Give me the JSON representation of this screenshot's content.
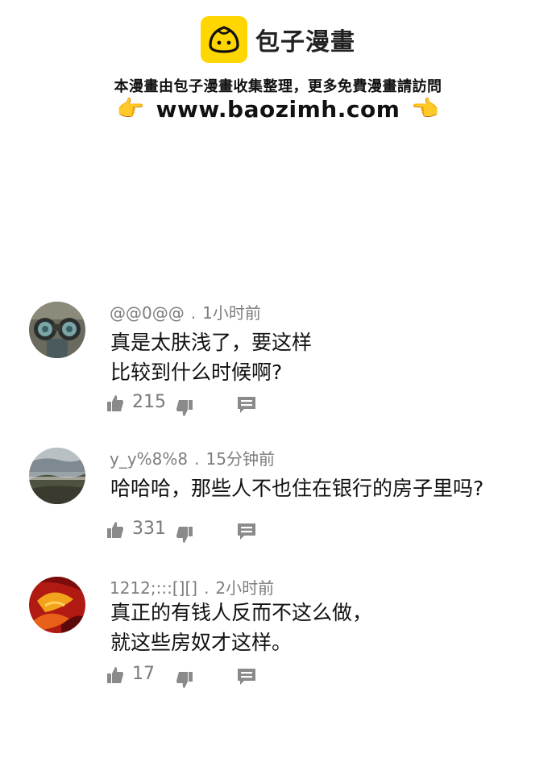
{
  "header": {
    "brand_name": "包子漫畫",
    "tagline": "本漫畫由包子漫畫收集整理，更多免費漫畫請訪問",
    "url": "www.baozimh.com",
    "left_hand": "👉",
    "right_hand": "👈",
    "logo_color": "#FFD600"
  },
  "comments": [
    {
      "username": "@@0@@",
      "separator": ".",
      "time": "1小时前",
      "lines": [
        "真是太肤浅了，要这样",
        "比较到什么时候啊?"
      ],
      "likes": "215",
      "avatar": "binoculars-avatar"
    },
    {
      "username": "y_y%8%8",
      "separator": ".",
      "time": "15分钟前",
      "lines": [
        "哈哈哈，那些人不也住在银行的房子里吗?"
      ],
      "likes": "331",
      "avatar": "landscape-avatar"
    },
    {
      "username": "1212;:::[][]",
      "separator": ".",
      "time": "2小时前",
      "lines": [
        "真正的有钱人反而不这么做，",
        "就这些房奴才这样。"
      ],
      "likes": "17",
      "avatar": "abstract-red-avatar"
    }
  ],
  "icons": {
    "like": "thumbs-up-icon",
    "dislike": "thumbs-down-icon",
    "reply": "reply-icon"
  },
  "colors": {
    "meta_text": "#7d7d7d",
    "icon": "#8a8a8a",
    "body_text": "#111111"
  }
}
